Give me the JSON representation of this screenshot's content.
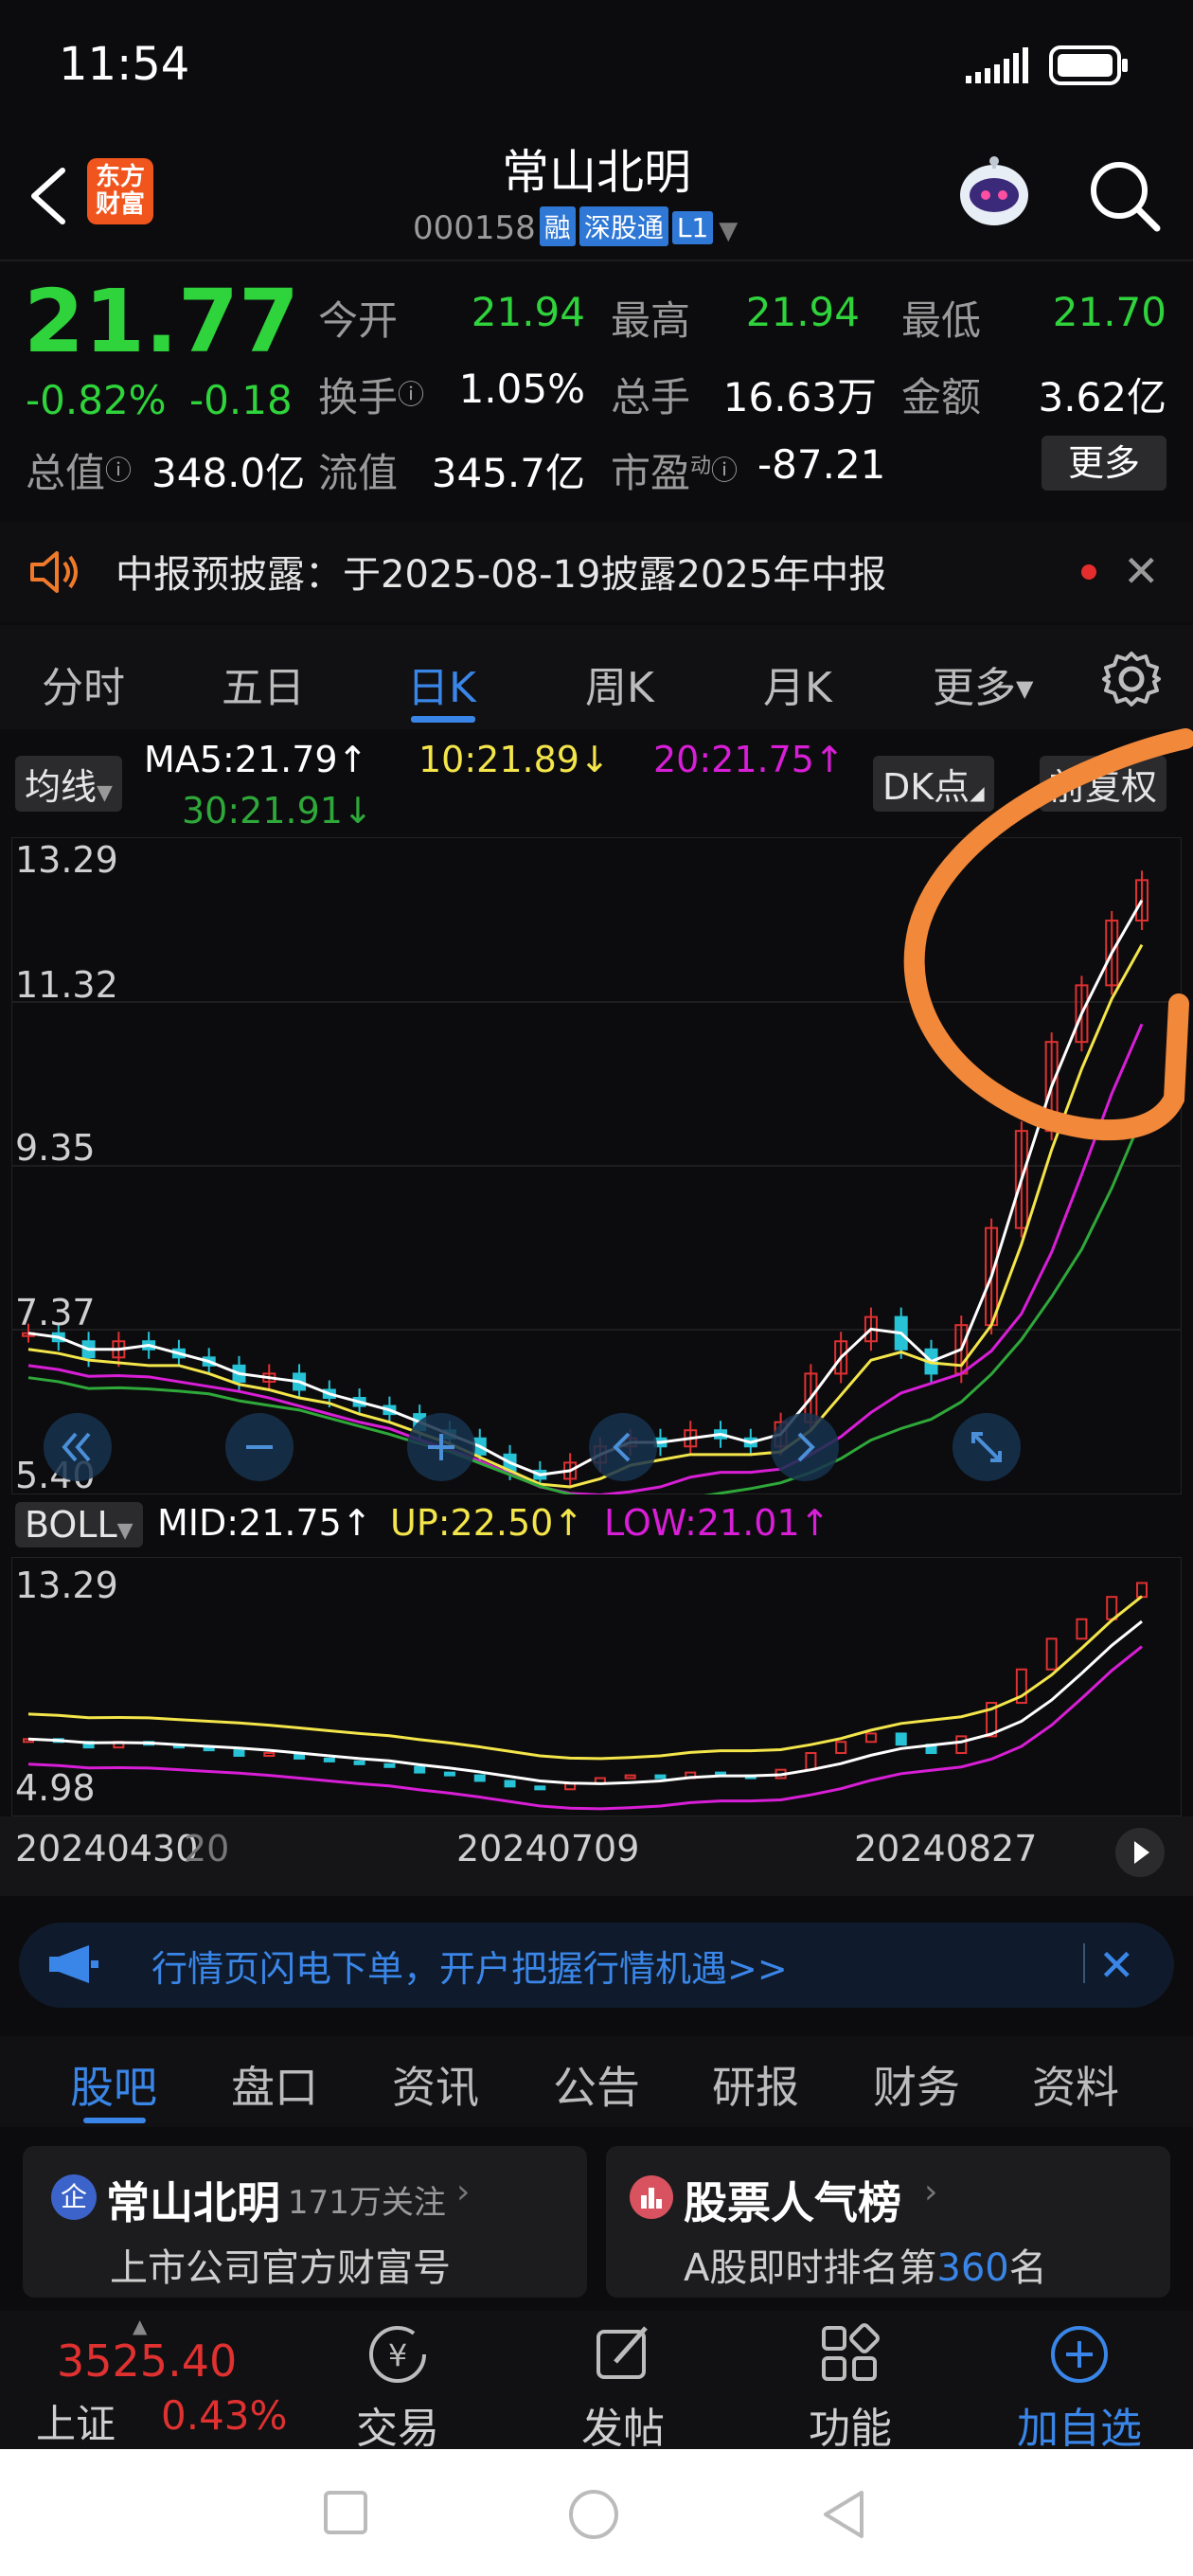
{
  "status": {
    "time": "11:54",
    "signal_icon": "signal-icon",
    "battery_icon": "battery-icon"
  },
  "header": {
    "back_icon": "chevron-left-icon",
    "app_logo": "东方财富",
    "stock_name": "常山北明",
    "stock_code": "000158",
    "tags": [
      "融",
      "深股通",
      "L1"
    ],
    "robot_icon": "robot-avatar-icon",
    "search_icon": "search-icon"
  },
  "quote": {
    "price": "21.77",
    "change_pct": "-0.82%",
    "change_amt": "-0.18",
    "today_open_label": "今开",
    "today_open": "21.94",
    "high_label": "最高",
    "high": "21.94",
    "low_label": "最低",
    "low": "21.70",
    "turnover_label": "换手",
    "turnover": "1.05%",
    "volume_label": "总手",
    "volume": "16.63万",
    "amount_label": "金额",
    "amount": "3.62亿",
    "total_value_label": "总值",
    "total_value": "348.0亿",
    "float_value_label": "流值",
    "float_value": "345.7亿",
    "pe_label": "市盈",
    "pe_sup": "动",
    "pe": "-87.21",
    "more_label": "更多"
  },
  "notice": {
    "icon": "speaker-icon",
    "text": "中报预披露：于2025-08-19披露2025年中报",
    "close_icon": "close-icon"
  },
  "chart_tabs": {
    "items": [
      "分时",
      "五日",
      "日K",
      "周K",
      "月K",
      "更多"
    ],
    "active": "日K",
    "settings_icon": "gear-icon"
  },
  "main_chart": {
    "indicator": "均线",
    "ma5": "MA5:21.79↑",
    "ma10": "10:21.89↓",
    "ma20": "20:21.75↑",
    "ma30": "30:21.91↓",
    "dk_label": "DK点",
    "adjust_label": "前复权",
    "y_labels": [
      "13.29",
      "11.32",
      "9.35",
      "7.37",
      "5.40"
    ],
    "controls": [
      "double-left-icon",
      "zoom-out-icon",
      "zoom-in-icon",
      "left-icon",
      "right-icon",
      "fullscreen-icon"
    ]
  },
  "sub_chart": {
    "indicator": "BOLL",
    "mid": "MID:21.75↑",
    "up": "UP:22.50↑",
    "low": "LOW:21.01↑",
    "y_labels": [
      "13.29",
      "4.98"
    ]
  },
  "x_axis": {
    "labels": [
      "20240430",
      "20",
      "20240709",
      "20240827"
    ],
    "next_icon": "play-icon"
  },
  "chart_data": {
    "type": "candlestick",
    "y_range": [
      5.4,
      13.29
    ],
    "candles_sampled": [
      7.3,
      7.2,
      7.0,
      7.2,
      7.1,
      7.0,
      6.9,
      6.7,
      6.8,
      6.6,
      6.5,
      6.4,
      6.3,
      6.1,
      6.0,
      5.8,
      5.6,
      5.5,
      5.7,
      5.9,
      6.0,
      5.9,
      6.1,
      6.0,
      5.9,
      6.2,
      6.8,
      7.2,
      7.5,
      7.1,
      6.8,
      7.4,
      8.6,
      9.8,
      10.9,
      11.6,
      12.4,
      12.9
    ],
    "colors": {
      "up": "#e03131",
      "down": "#27c2d6",
      "ma5": "#ffffff",
      "ma10": "#f3e54a",
      "ma20": "#d81ed6",
      "ma30": "#2fa83a",
      "boll_up": "#f3e54a",
      "boll_mid": "#ffffff",
      "boll_low": "#d81ed6"
    }
  },
  "ad": {
    "icon": "megaphone-icon",
    "text": "行情页闪电下单，开户把握行情机遇>>",
    "close_icon": "close-icon"
  },
  "bottom_tabs": {
    "items": [
      "股吧",
      "盘口",
      "资讯",
      "公告",
      "研报",
      "财务",
      "资料"
    ],
    "active": "股吧"
  },
  "cards": [
    {
      "badge": "企",
      "title": "常山北明",
      "follow": "171万关注",
      "sub": "上市公司官方财富号"
    },
    {
      "icon": "rank-icon",
      "title": "股票人气榜",
      "sub_prefix": "A股即时排名第",
      "rank": "360",
      "sub_suffix": "名"
    }
  ],
  "bottom_nav": {
    "index_value": "3525.40",
    "index_name": "上证",
    "index_pct": "0.43%",
    "items": [
      {
        "label": "交易",
        "icon": "trade-icon"
      },
      {
        "label": "发帖",
        "icon": "edit-icon"
      },
      {
        "label": "功能",
        "icon": "grid-icon"
      },
      {
        "label": "加自选",
        "icon": "plus-circle-icon"
      }
    ]
  },
  "system_nav": [
    "square-icon",
    "circle-icon",
    "triangle-back-icon"
  ]
}
